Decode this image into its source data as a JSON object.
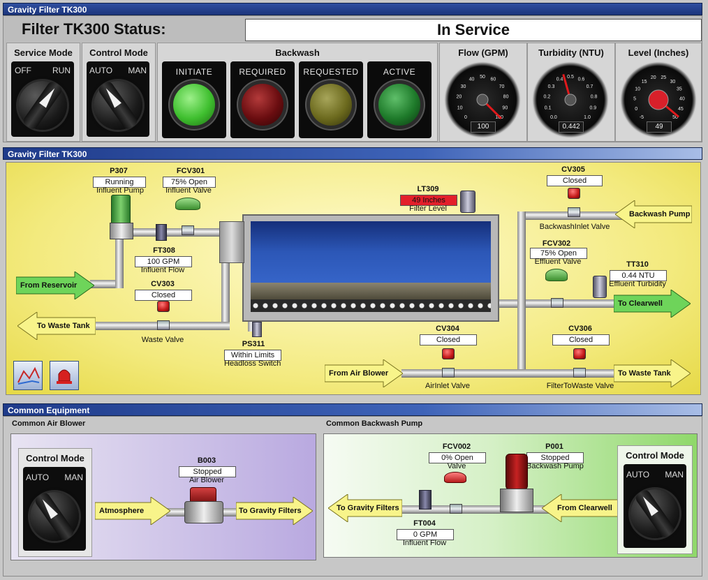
{
  "status_panel": {
    "title": "Gravity Filter TK300",
    "status_label": "Filter TK300 Status:",
    "status_value": "In Service",
    "service_mode": {
      "header": "Service Mode",
      "left": "OFF",
      "right": "RUN"
    },
    "control_mode": {
      "header": "Control Mode",
      "left": "AUTO",
      "right": "MAN"
    },
    "backwash": {
      "header": "Backwash",
      "lamps": [
        {
          "label": "INITIATE",
          "color": "#3fbf2f"
        },
        {
          "label": "REQUIRED",
          "color": "#6a0d10"
        },
        {
          "label": "REQUESTED",
          "color": "#6c6a1e"
        },
        {
          "label": "ACTIVE",
          "color": "#1e7a2a"
        }
      ]
    },
    "gauges": [
      {
        "header": "Flow (GPM)",
        "ticks": [
          "0",
          "10",
          "20",
          "30",
          "40",
          "50",
          "60",
          "70",
          "80",
          "90",
          "100"
        ],
        "value": "100",
        "value_num": 100,
        "max": 100
      },
      {
        "header": "Turbidity (NTU)",
        "ticks": [
          "0.0",
          "0.1",
          "0.2",
          "0.3",
          "0.4",
          "0.5",
          "0.6",
          "0.7",
          "0.8",
          "0.9",
          "1.0"
        ],
        "value": "0.442",
        "value_num": 0.442,
        "max": 1.0
      },
      {
        "header": "Level (Inches)",
        "ticks": [
          "-5",
          "0",
          "5",
          "10",
          "15",
          "20",
          "25",
          "30",
          "35",
          "40",
          "45",
          "50"
        ],
        "value": "49",
        "value_num": 49,
        "max": 50
      }
    ]
  },
  "process_panel": {
    "title": "Gravity Filter TK300",
    "p307": {
      "tag": "P307",
      "value": "Running",
      "desc": "Influent Pump"
    },
    "fcv301": {
      "tag": "FCV301",
      "value": "75% Open",
      "desc": "Influent Valve"
    },
    "ft308": {
      "tag": "FT308",
      "value": "100 GPM",
      "desc": "Influent Flow"
    },
    "cv303": {
      "tag": "CV303",
      "value": "Closed",
      "desc": "Waste Valve"
    },
    "lt309": {
      "tag": "LT309",
      "value": "49 Inches",
      "desc": "Filter Level"
    },
    "ps311": {
      "tag": "PS311",
      "value": "Within Limits",
      "desc": "Headloss Switch"
    },
    "cv305": {
      "tag": "CV305",
      "value": "Closed",
      "desc": "BackwashInlet Valve"
    },
    "fcv302": {
      "tag": "FCV302",
      "value": "75% Open",
      "desc": "Effluent Valve"
    },
    "tt310": {
      "tag": "TT310",
      "value": "0.44 NTU",
      "desc": "Effluent Turbidity"
    },
    "cv304": {
      "tag": "CV304",
      "value": "Closed",
      "desc": "AirInlet Valve"
    },
    "cv306": {
      "tag": "CV306",
      "value": "Closed",
      "desc": "FilterToWaste Valve"
    },
    "arrows": {
      "from_reservoir": "From Reservoir",
      "to_waste_tank_left": "To Waste Tank",
      "backwash_pump": "Backwash Pump",
      "to_clearwell": "To Clearwell",
      "from_air_blower": "From Air Blower",
      "to_waste_tank_right": "To Waste Tank"
    }
  },
  "common_panel": {
    "title": "Common Equipment",
    "air_blower": {
      "header": "Common Air Blower",
      "control_mode": {
        "header": "Control Mode",
        "left": "AUTO",
        "right": "MAN"
      },
      "b003": {
        "tag": "B003",
        "value": "Stopped",
        "desc": "Air Blower"
      },
      "atmosphere": "Atmosphere",
      "to_gravity_filters": "To Gravity Filters"
    },
    "backwash_pump": {
      "header": "Common Backwash Pump",
      "control_mode": {
        "header": "Control Mode",
        "left": "AUTO",
        "right": "MAN"
      },
      "fcv002": {
        "tag": "FCV002",
        "value": "0% Open",
        "desc": "Valve"
      },
      "p001": {
        "tag": "P001",
        "value": "Stopped",
        "desc": "Backwash Pump"
      },
      "ft004": {
        "tag": "FT004",
        "value": "0 GPM",
        "desc": "Influent Flow"
      },
      "to_gravity_filters": "To Gravity Filters",
      "from_clearwell": "From Clearwell"
    }
  }
}
